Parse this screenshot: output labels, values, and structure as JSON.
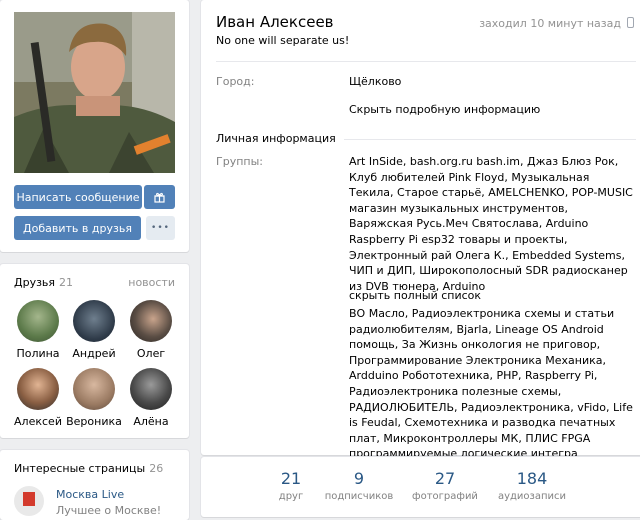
{
  "profile": {
    "name": "Иван Алексеев",
    "status": "No one will separate us!",
    "last_seen": "заходил 10 минут назад"
  },
  "actions": {
    "message_label": "Написать сообщение",
    "add_friend_label": "Добавить в друзья",
    "more_label": "•••"
  },
  "info": {
    "city_label": "Город:",
    "city_value": "Щёлково",
    "hide_details": "Скрыть подробную информацию",
    "personal_title": "Личная информация",
    "groups_label": "Группы:",
    "groups_text_1": "Art InSide, bash.org.ru bash.im, Джаз Блюз Рок, Клуб любителей Pink Floyd, Музыкальная Текила, Старое старьё, AMELCHENKO, POP-MUSIC магазин музыкальных инструментов, Варяжская Русь.Меч Святослава, Arduino Raspberry Pi esp32 товары и проекты, Электронный рай Олега К., Embedded Systems, ЧИП и ДИП, Широкополосный SDR радиосканер из DVB тюнера, Arduino",
    "hide_full_list": "скрыть полный список",
    "groups_text_2": "ВО Масло, Радиоэлектроника схемы и статьи радиолюбителям, Bjarla, Lineage OS Android помощь, За Жизнь онкология не приговор, Программирование Электроника Механика, Ardduino Робототехника, PHP, Raspberry Pi, Радиоэлектроника полезные схемы, РАДИОЛЮБИТЕЛЬ, Радиоэлектроника, vFido, Life is Feudal, Схемотехника и разводка печатных плат, Микроконтроллеры МК, ПЛИС FPGA программируемые логические интегра"
  },
  "friends": {
    "title": "Друзья",
    "count": "21",
    "news_link": "новости",
    "items": [
      {
        "name": "Полина",
        "color": "#6b8a5a"
      },
      {
        "name": "Андрей",
        "color": "#3a4a5c"
      },
      {
        "name": "Олег",
        "color": "#5a4d44"
      },
      {
        "name": "Алексей",
        "color": "#7a5c48"
      },
      {
        "name": "Вероника",
        "color": "#8a6a58"
      },
      {
        "name": "Алёна",
        "color": "#3d3d3d"
      }
    ]
  },
  "pages": {
    "title": "Интересные страницы",
    "count": "26",
    "first_name": "Москва Live",
    "first_desc": "Лучшее о Москве!",
    "first_color": "#d33a2c"
  },
  "counters": [
    {
      "num": "21",
      "label": "друг"
    },
    {
      "num": "9",
      "label": "подписчиков"
    },
    {
      "num": "27",
      "label": "фотографий"
    },
    {
      "num": "184",
      "label": "аудиозаписи"
    }
  ]
}
